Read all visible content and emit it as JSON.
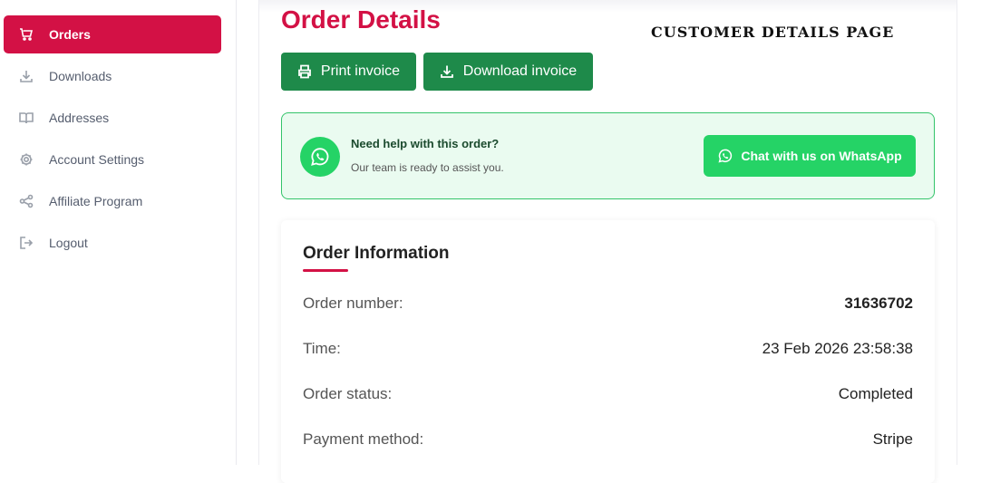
{
  "sidebar": {
    "items": [
      {
        "label": "Orders",
        "icon": "cart-icon",
        "active": true
      },
      {
        "label": "Downloads",
        "icon": "download-icon"
      },
      {
        "label": "Addresses",
        "icon": "book-icon"
      },
      {
        "label": "Account Settings",
        "icon": "gear-icon"
      },
      {
        "label": "Affiliate Program",
        "icon": "share-icon"
      },
      {
        "label": "Logout",
        "icon": "logout-icon"
      }
    ]
  },
  "main": {
    "title": "Order Details",
    "stamp": "CUSTOMER DETAILS PAGE",
    "print_button": "Print invoice",
    "download_button": "Download invoice"
  },
  "help": {
    "title": "Need help with this order?",
    "subtitle": "Our team is ready to assist you.",
    "button": "Chat with us on WhatsApp"
  },
  "order_info": {
    "title": "Order Information",
    "rows": [
      {
        "label": "Order number:",
        "value": "31636702"
      },
      {
        "label": "Time:",
        "value": "23 Feb 2026 23:58:38"
      },
      {
        "label": "Order status:",
        "value": "Completed"
      },
      {
        "label": "Payment method:",
        "value": "Stripe"
      }
    ]
  },
  "colors": {
    "brand": "#d31145",
    "invoice_button": "#1e8a4a",
    "whatsapp": "#25d366"
  }
}
